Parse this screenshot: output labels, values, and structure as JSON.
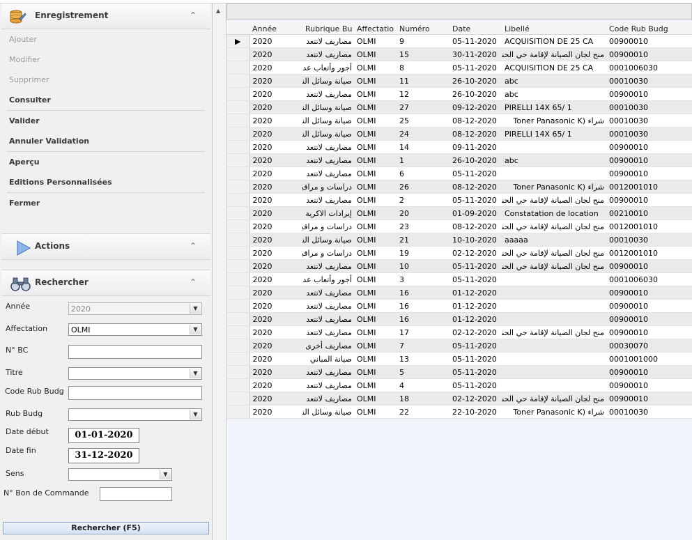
{
  "left_panel": {
    "enregistrement": {
      "title": "Enregistrement",
      "items": [
        {
          "label": "Ajouter",
          "enabled": false
        },
        {
          "label": "Modifier",
          "enabled": false
        },
        {
          "label": "Supprimer",
          "enabled": false
        },
        {
          "label": "Consulter",
          "enabled": true
        },
        {
          "label": "Valider",
          "enabled": true
        },
        {
          "label": "Annuler Validation",
          "enabled": true
        },
        {
          "label": "Aperçu",
          "enabled": true
        },
        {
          "label": "Editions Personnalisées",
          "enabled": true
        },
        {
          "label": "Fermer",
          "enabled": true
        }
      ]
    },
    "actions": {
      "title": "Actions"
    },
    "rechercher": {
      "title": "Rechercher",
      "fields": {
        "annee": {
          "label": "Année",
          "value": "2020"
        },
        "affectation": {
          "label": "Affectation",
          "value": "OLMI"
        },
        "num_bc": {
          "label": "N° BC",
          "value": ""
        },
        "titre": {
          "label": "Titre",
          "value": ""
        },
        "code_rub_budg": {
          "label": "Code Rub Budg",
          "value": ""
        },
        "rub_budg": {
          "label": "Rub Budg",
          "value": ""
        },
        "date_debut": {
          "label": "Date début",
          "value": "01-01-2020"
        },
        "date_fin": {
          "label": "Date fin",
          "value": "31-12-2020"
        },
        "sens": {
          "label": "Sens",
          "value": ""
        },
        "num_bon_commande": {
          "label": "N° Bon de Commande",
          "value": ""
        }
      },
      "button_label": "Rechercher (F5)"
    }
  },
  "grid": {
    "columns": [
      "Année",
      "Rubrique Bu",
      "Affectatio",
      "Numéro",
      "Date",
      "Libellé",
      "Code Rub Budg"
    ],
    "rows": [
      [
        "2020",
        "مصاريف لاتتعد",
        "OLMI",
        "9",
        "05-11-2020",
        "ACQUISITION DE 25 CA",
        "00900010"
      ],
      [
        "2020",
        "مصاريف لاتتعد",
        "OLMI",
        "15",
        "30-11-2020",
        "منح لجان الصيانة لإقامة حي الحنا",
        "00900010"
      ],
      [
        "2020",
        "أجور وأتعاب عد",
        "OLMI",
        "8",
        "05-11-2020",
        "ACQUISITION DE 25 CA",
        "0001006030"
      ],
      [
        "2020",
        "صيانة وسائل النق",
        "OLMI",
        "11",
        "26-10-2020",
        "abc",
        "00010030"
      ],
      [
        "2020",
        "مصاريف لاتتعد",
        "OLMI",
        "12",
        "26-10-2020",
        "abc",
        "00900010"
      ],
      [
        "2020",
        "صيانة وسائل النق",
        "OLMI",
        "27",
        "09-12-2020",
        "    PIRELLI   14X 65/ 1",
        "00010030"
      ],
      [
        "2020",
        "صيانة وسائل النق",
        "OLMI",
        "25",
        "08-12-2020",
        "شراء (Toner Panasonic K",
        "00010030"
      ],
      [
        "2020",
        "صيانة وسائل النق",
        "OLMI",
        "24",
        "08-12-2020",
        "    PIRELLI   14X 65/ 1",
        "00010030"
      ],
      [
        "2020",
        "مصاريف لاتتعد",
        "OLMI",
        "14",
        "09-11-2020",
        "",
        "00900010"
      ],
      [
        "2020",
        "مصاريف لاتتعد",
        "OLMI",
        "1",
        "26-10-2020",
        "abc",
        "00900010"
      ],
      [
        "2020",
        "مصاريف لاتتعد",
        "OLMI",
        "6",
        "05-11-2020",
        "",
        "00900010"
      ],
      [
        "2020",
        "دراسات و مراقبة",
        "OLMI",
        "26",
        "08-12-2020",
        "شراء (Toner Panasonic K",
        "0012001010"
      ],
      [
        "2020",
        "مصاريف لاتتعد",
        "OLMI",
        "2",
        "05-11-2020",
        "منح لجان الصيانة لإقامة حي الحنا",
        "00900010"
      ],
      [
        "2020",
        "إيرادات الاكرية",
        "OLMI",
        "20",
        "01-09-2020",
        "Constatation de location",
        "00210010"
      ],
      [
        "2020",
        "دراسات و مراقبة",
        "OLMI",
        "23",
        "08-12-2020",
        "منح لجان الصيانة لإقامة حي الحنا",
        "0012001010"
      ],
      [
        "2020",
        "صيانة وسائل النق",
        "OLMI",
        "21",
        "10-10-2020",
        "aaaaa",
        "00010030"
      ],
      [
        "2020",
        "دراسات و مراقبة",
        "OLMI",
        "19",
        "02-12-2020",
        "منح لجان الصيانة لإقامة حي الحنا",
        "0012001010"
      ],
      [
        "2020",
        "مصاريف لاتتعد",
        "OLMI",
        "10",
        "05-11-2020",
        "منح لجان الصيانة لإقامة حي الحنا",
        "00900010"
      ],
      [
        "2020",
        "أجور وأتعاب عد",
        "OLMI",
        "3",
        "05-11-2020",
        "",
        "0001006030"
      ],
      [
        "2020",
        "مصاريف لاتتعد",
        "OLMI",
        "16",
        "01-12-2020",
        "",
        "00900010"
      ],
      [
        "2020",
        "مصاريف لاتتعد",
        "OLMI",
        "16",
        "01-12-2020",
        "",
        "00900010"
      ],
      [
        "2020",
        "مصاريف لاتتعد",
        "OLMI",
        "16",
        "01-12-2020",
        "",
        "00900010"
      ],
      [
        "2020",
        "مصاريف لاتتعد",
        "OLMI",
        "17",
        "02-12-2020",
        "منح لجان الصيانة لإقامة حي الحنا",
        "00900010"
      ],
      [
        "2020",
        "مصاريف أخرى",
        "OLMI",
        "7",
        "05-11-2020",
        "",
        "00030070"
      ],
      [
        "2020",
        "صيانة المباني",
        "OLMI",
        "13",
        "05-11-2020",
        "",
        "0001001000"
      ],
      [
        "2020",
        "مصاريف لاتتعد",
        "OLMI",
        "5",
        "05-11-2020",
        "",
        "00900010"
      ],
      [
        "2020",
        "مصاريف لاتتعد",
        "OLMI",
        "4",
        "05-11-2020",
        "",
        "00900010"
      ],
      [
        "2020",
        "مصاريف لاتتعد",
        "OLMI",
        "18",
        "02-12-2020",
        "منح لجان الصيانة لإقامة حي الحنا",
        "00900010"
      ],
      [
        "2020",
        "صيانة وسائل النق",
        "OLMI",
        "22",
        "22-10-2020",
        "شراء (Toner Panasonic K",
        "00010030"
      ]
    ],
    "selected_row_marker": "▶"
  },
  "colors": {
    "accent_blue": "#4a86d4",
    "panel_bg": "#f0f0f0",
    "grid_bg": "#f2f6fc"
  }
}
